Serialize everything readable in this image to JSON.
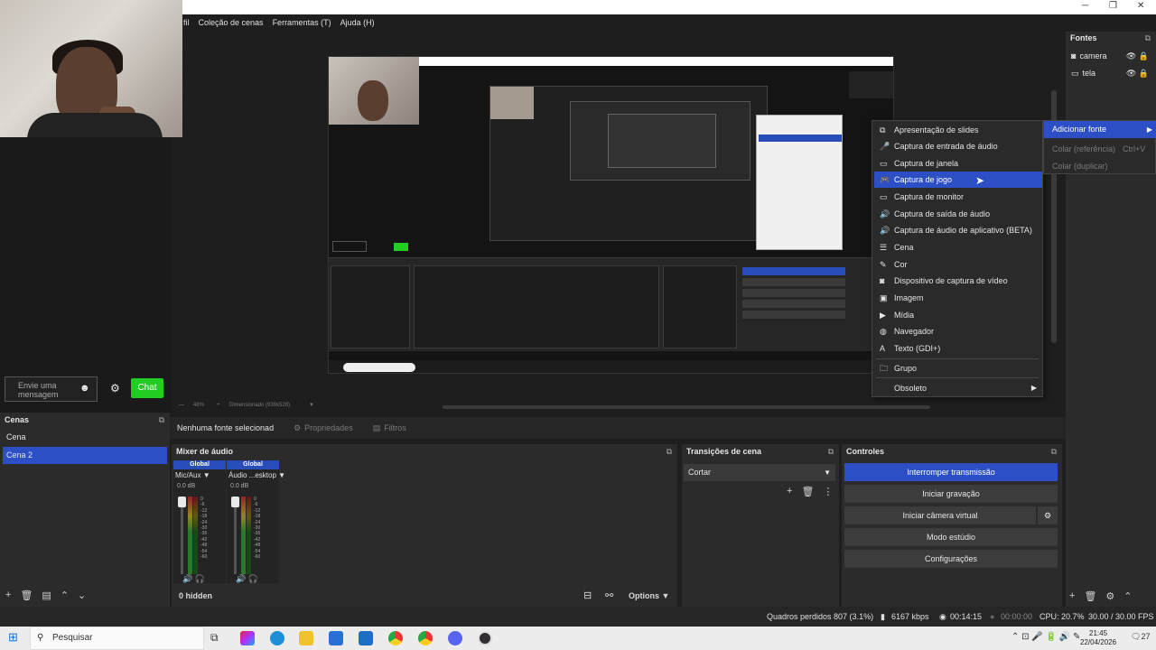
{
  "menubar": {
    "items": [
      "fil",
      "Coleção de cenas",
      "Ferramentas (T)",
      "Ajuda (H)"
    ]
  },
  "window_controls": [
    "─",
    "❐",
    "✕"
  ],
  "chat": {
    "placeholder": "Envie uma mensagem",
    "button": "Chat"
  },
  "preview_zoom": {
    "percent": "48%",
    "resolution": "Dimensionado (939x528)"
  },
  "scenes": {
    "title": "Cenas",
    "items": [
      "Cena",
      "Cena 2"
    ],
    "selected": "Cena 2"
  },
  "sources_bar": {
    "none_selected": "Nenhuma fonte selecionad",
    "properties": "Propriedades",
    "filters": "Filtros"
  },
  "mixer": {
    "title": "Mixer de áudio",
    "channels": [
      {
        "badge": "Global",
        "name": "Mic/Aux",
        "db": "0.0 dB"
      },
      {
        "badge": "Global",
        "name": "Áudio ...esktop",
        "db": "0.0 dB"
      }
    ],
    "scale": [
      "0",
      "-6",
      "-12",
      "-18",
      "-24",
      "-30",
      "-36",
      "-42",
      "-48",
      "-54",
      "-60"
    ],
    "hidden": "0 hidden",
    "options": "Options"
  },
  "transitions": {
    "title": "Transições de cena",
    "selected": "Cortar"
  },
  "controls": {
    "title": "Controles",
    "stop_stream": "Interromper transmissão",
    "start_recording": "Iniciar gravação",
    "start_vcam": "Iniciar câmera virtual",
    "studio_mode": "Modo estúdio",
    "settings": "Configurações"
  },
  "sources": {
    "title": "Fontes",
    "items": [
      "camera",
      "tela"
    ]
  },
  "context_menu": {
    "items": [
      "Apresentação de slides",
      "Captura de entrada de áudio",
      "Captura de janela",
      "Captura de jogo",
      "Captura de monitor",
      "Captura de saída de áudio",
      "Captura de áudio de aplicativo (BETA)",
      "Cena",
      "Cor",
      "Dispositivo de captura de vídeo",
      "Imagem",
      "Mídia",
      "Navegador",
      "Texto (GDI+)",
      "Grupo",
      "Obsoleto"
    ],
    "highlighted": "Captura de jogo"
  },
  "submenu_parent": {
    "add_source": "Adicionar fonte",
    "paste_ref": "Colar (referência)",
    "paste_ref_shortcut": "Ctrl+V",
    "paste_dup": "Colar (duplicar)"
  },
  "status": {
    "dropped": "Quadros perdidos 807 (3.1%)",
    "bitrate": "6167 kbps",
    "stream_time": "00:14:15",
    "rec_time": "00:00:00",
    "cpu": "CPU: 20.7%",
    "fps": "30.00 / 30.00 FPS"
  },
  "taskbar": {
    "search": "Pesquisar",
    "time": "21:45",
    "date": "22/04/2026",
    "notif": "27"
  },
  "colors": {
    "accent": "#2c4fc6",
    "chat_green": "#22cc22",
    "panel": "#2b2b2b",
    "bg": "#1e1e1e"
  }
}
